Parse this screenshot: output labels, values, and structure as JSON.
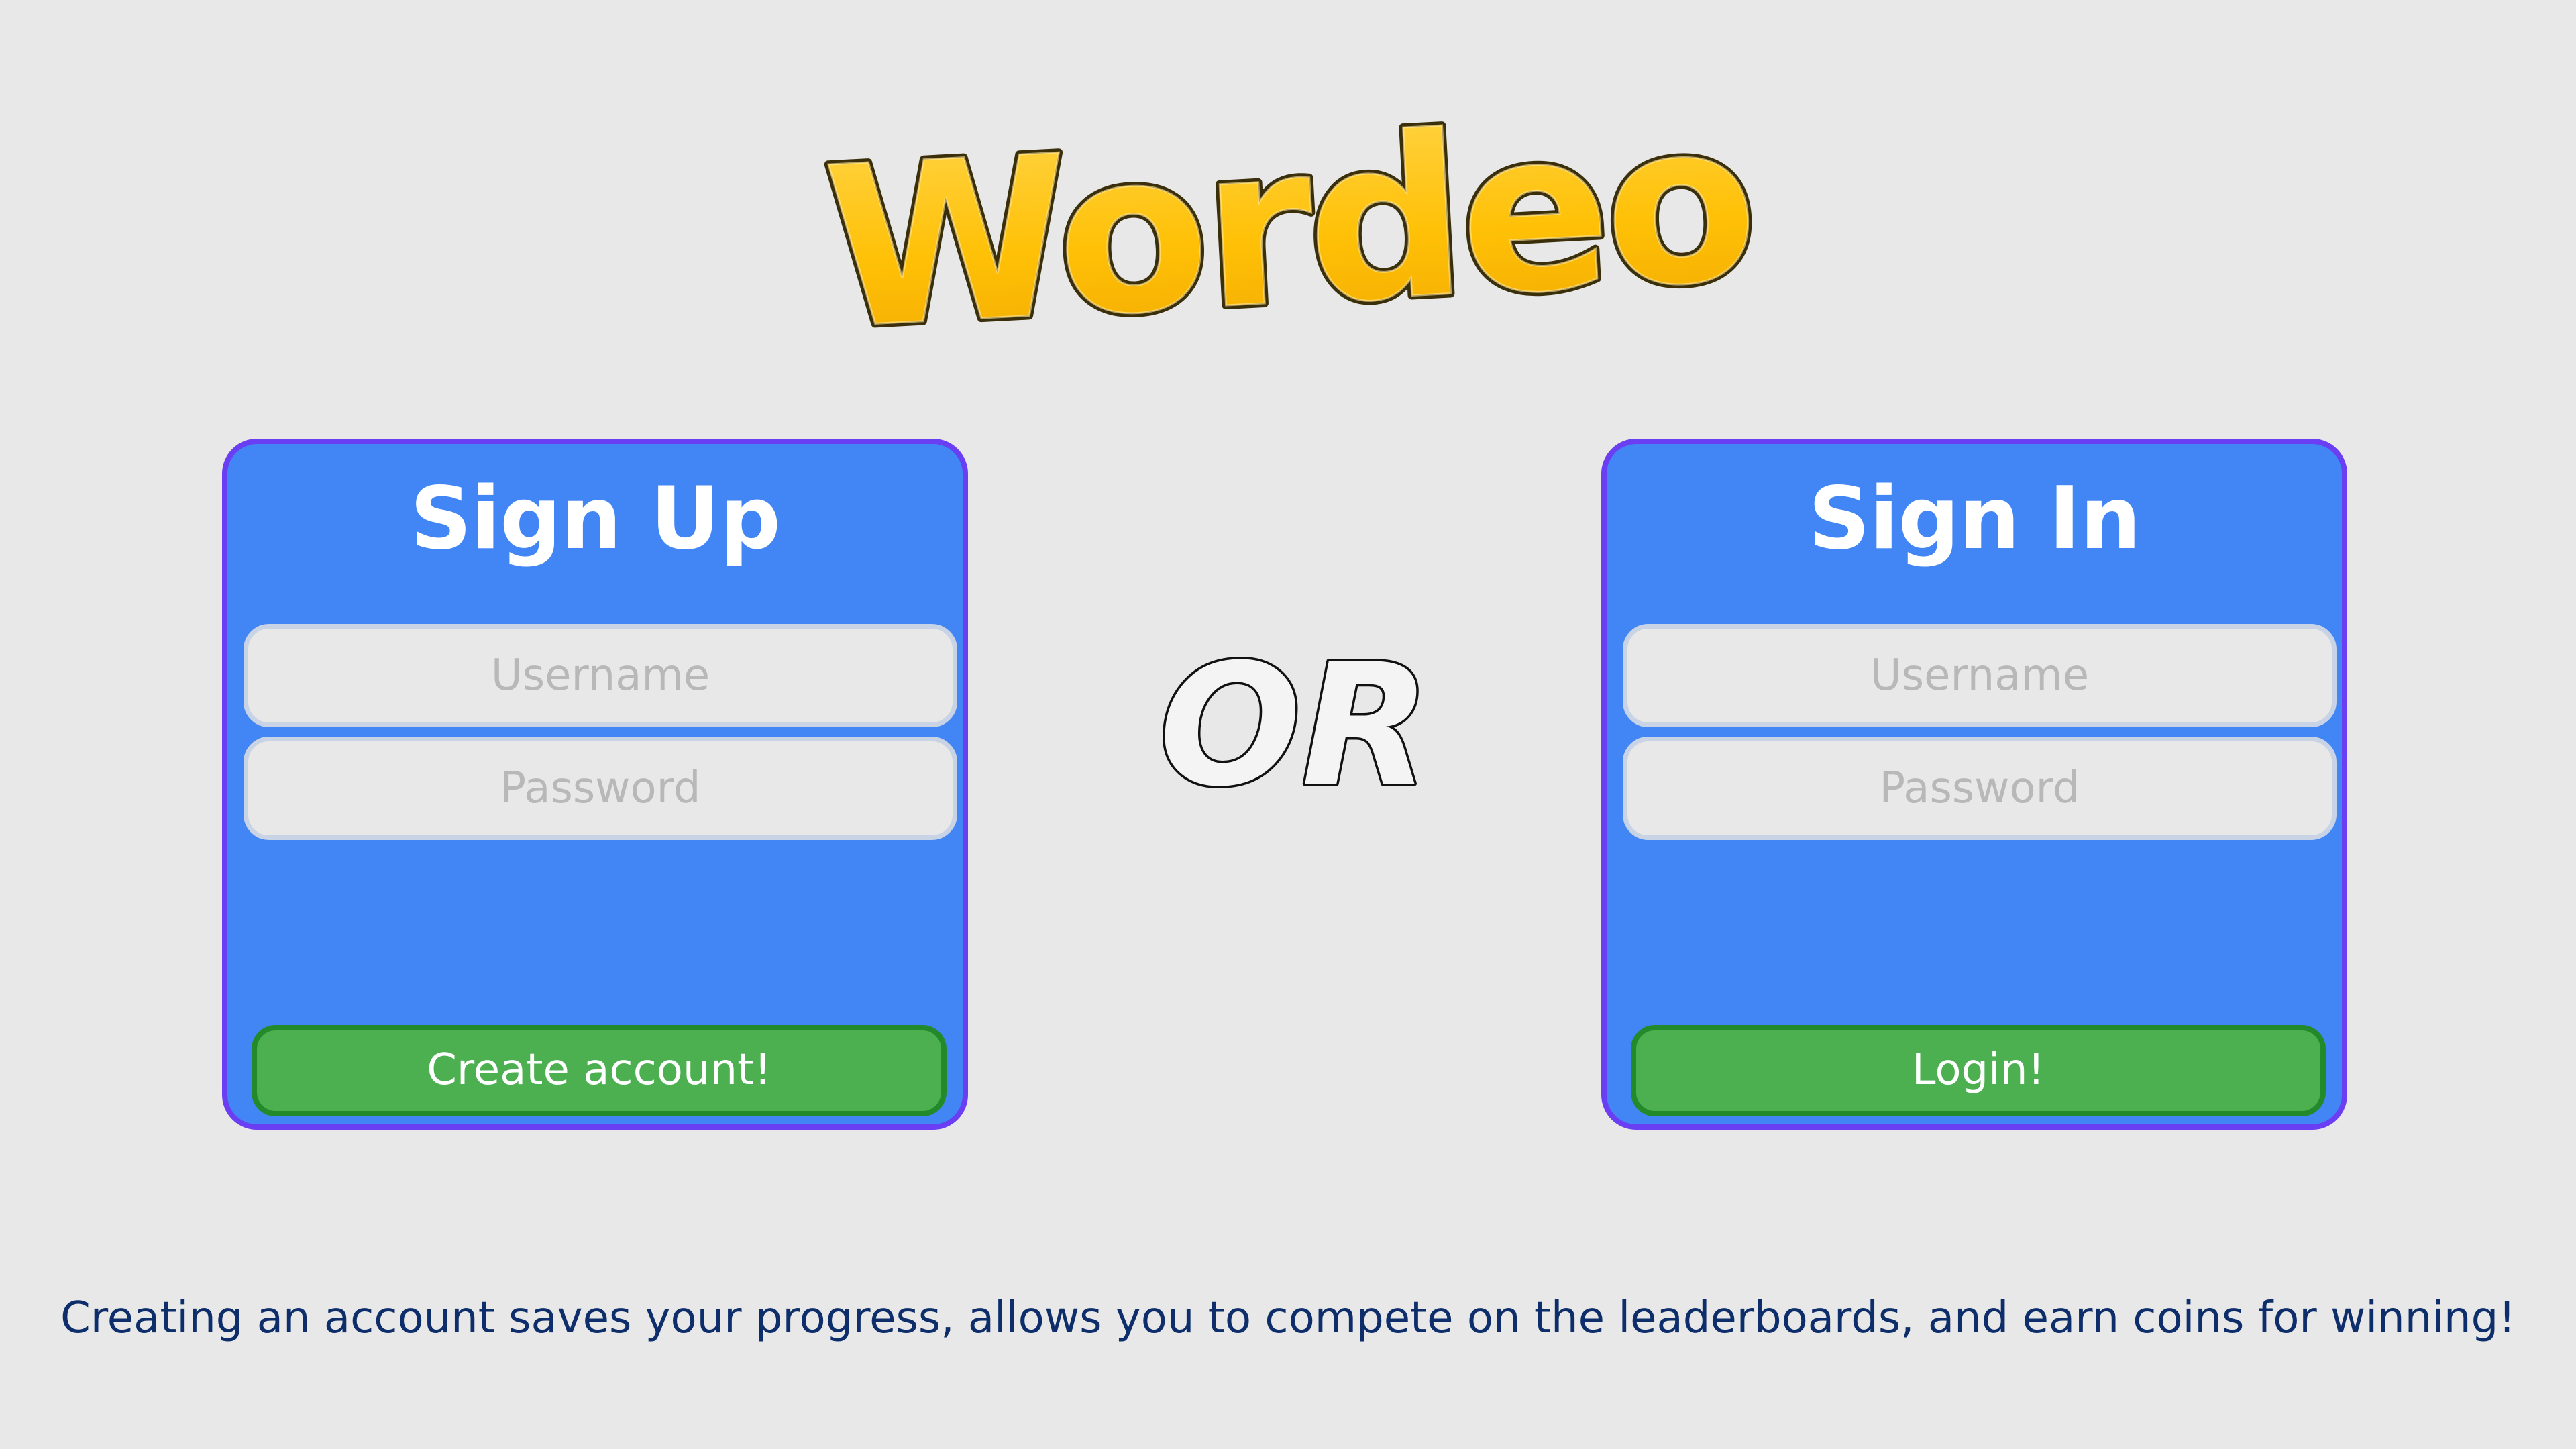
{
  "app": {
    "logo_text": "Wordeo",
    "logo_colors": {
      "fill": "#ffc107",
      "stroke": "#3a2f0a",
      "highlight": "#ffe27a"
    }
  },
  "signup": {
    "title": "Sign Up",
    "username_placeholder": "Username",
    "password_placeholder": "Password",
    "button_label": "Create account!"
  },
  "separator": {
    "text": "OR"
  },
  "signin": {
    "title": "Sign In",
    "username_placeholder": "Username",
    "password_placeholder": "Password",
    "button_label": "Login!"
  },
  "footer": {
    "note": "Creating an account saves your progress, allows you to compete on the leaderboards, and earn coins for winning!"
  },
  "colors": {
    "background": "#e8e8e8",
    "panel": "#4285f4",
    "panel_border": "#6a3ef2",
    "button": "#4caf50",
    "button_border": "#238a2b",
    "footer_text": "#0d2e6b"
  }
}
